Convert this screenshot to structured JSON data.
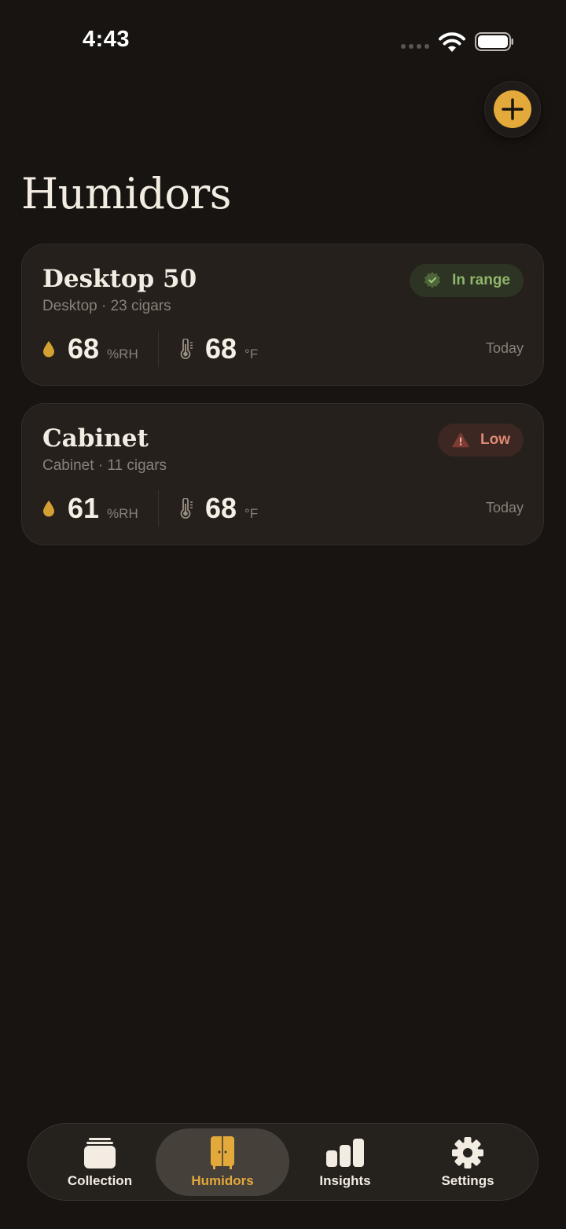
{
  "status_bar": {
    "time": "4:43"
  },
  "header": {
    "title": "Humidors",
    "add_icon": "plus-icon"
  },
  "humidors": [
    {
      "name": "Desktop 50",
      "subtitle": "Desktop · 23 cigars",
      "status": "In range",
      "status_icon": "shield-check-icon",
      "humidity": "68",
      "humidity_unit": "%RH",
      "temperature": "68",
      "temperature_unit": "°F",
      "updated": "Today"
    },
    {
      "name": "Cabinet",
      "subtitle": "Cabinet · 11 cigars",
      "status": "Low",
      "status_icon": "warning-triangle-icon",
      "humidity": "61",
      "humidity_unit": "%RH",
      "temperature": "68",
      "temperature_unit": "°F",
      "updated": "Today"
    }
  ],
  "tab_bar": {
    "tabs": [
      {
        "label": "Collection",
        "icon": "cards-stack-icon"
      },
      {
        "label": "Humidors",
        "icon": "cabinet-icon",
        "active": true
      },
      {
        "label": "Insights",
        "icon": "bar-chart-icon"
      },
      {
        "label": "Settings",
        "icon": "gear-icon"
      }
    ]
  },
  "colors": {
    "background": "#181411",
    "accent": "#e3a93a",
    "ok": "#8fb56a",
    "low": "#de8a76"
  }
}
